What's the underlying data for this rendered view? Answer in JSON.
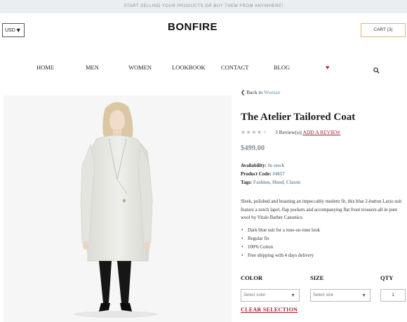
{
  "banner": {
    "text": "START SELLING YOUR PRODUCTS OR BUY THEM FROM ANYWHERE!"
  },
  "header": {
    "currency": "USD",
    "logo": "BONFIRE",
    "cart_label": "CART (3)"
  },
  "nav": {
    "items": [
      "HOME",
      "MEN",
      "WOMEN",
      "LOOKBOOK",
      "CONTACT",
      "BLOG"
    ],
    "heart_icon": "heart-icon",
    "search_icon": "search-icon",
    "heart_color": "#c2185b"
  },
  "breadcrumb": {
    "prefix": "Back to",
    "link": "Woman"
  },
  "product": {
    "title": "The Atelier Tailored Coat",
    "rating": 4,
    "rating_max": 5,
    "reviews": "3 Review(s)",
    "separator": "|",
    "add_review": "ADD A REVIEW",
    "price": "$499.00",
    "availability_label": "Availability:",
    "availability_value": "In stock",
    "code_label": "Product Code:",
    "code_value": "#4657",
    "tags_label": "Tags:",
    "tags_value": "Fashion, Hood, Classic",
    "description": "Sleek, polished and boasting an impeccably modern fit, this blue 2-button Lazio suit feature a notch lapel, flap pockets and accompanying flat front trousers-all in pure wool by Vitale Barber Canonico.",
    "features": [
      "Dark blue suit for a tone-on-tone look",
      "Regular fix",
      "100% Cotton",
      "Free shipping with 4 days delivery"
    ]
  },
  "options": {
    "color_label": "COLOR",
    "size_label": "SIZE",
    "qty_label": "QTY",
    "color_placeholder": "Select color",
    "size_placeholder": "Select size",
    "qty_value": "1",
    "clear_label": "CLEAR SELECTION"
  }
}
